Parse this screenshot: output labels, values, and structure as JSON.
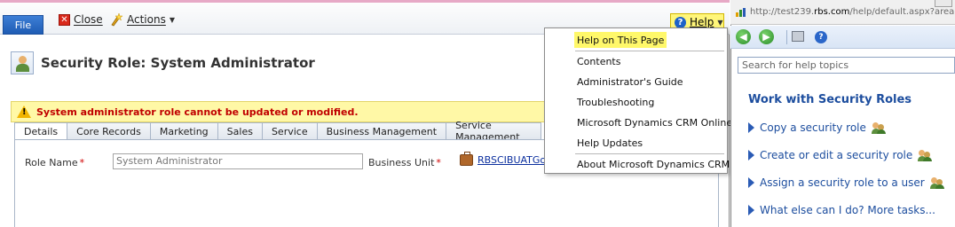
{
  "toolbar": {
    "file_label": "File",
    "close_label": "Close",
    "actions_label": "Actions",
    "help_label": "Help"
  },
  "page": {
    "title": "Security Role: System Administrator",
    "warning": "System administrator role cannot be updated or modified."
  },
  "tabs": [
    {
      "label": "Details",
      "active": true
    },
    {
      "label": "Core Records"
    },
    {
      "label": "Marketing"
    },
    {
      "label": "Sales"
    },
    {
      "label": "Service"
    },
    {
      "label": "Business Management"
    },
    {
      "label": "Service Management"
    }
  ],
  "form": {
    "role_name_label": "Role Name",
    "role_name_value": "System Administrator",
    "business_unit_label": "Business Unit",
    "business_unit_value": "RBSCIBUATGo",
    "required_marker": "*"
  },
  "help_menu": {
    "items": [
      {
        "label": "Help on This Page",
        "highlighted": true
      },
      {
        "label": "Contents"
      },
      {
        "label": "Administrator's Guide"
      },
      {
        "label": "Troubleshooting"
      },
      {
        "label": "Microsoft Dynamics CRM Online"
      },
      {
        "label": "Help Updates"
      },
      {
        "label": "About Microsoft Dynamics CRM"
      }
    ]
  },
  "help_window": {
    "url_prefix": "http://test239.",
    "url_domain": "rbs.com",
    "url_suffix": "/help/default.aspx?area=",
    "search_placeholder": "Search for help topics",
    "heading": "Work with Security Roles",
    "links": [
      "Copy a security role",
      "Create or edit a security role",
      "Assign a security role to a user",
      "What else can I do? More tasks..."
    ]
  },
  "colors": {
    "highlight": "#fff67a",
    "warning_text": "#c00000",
    "link": "#1c4d9e"
  }
}
